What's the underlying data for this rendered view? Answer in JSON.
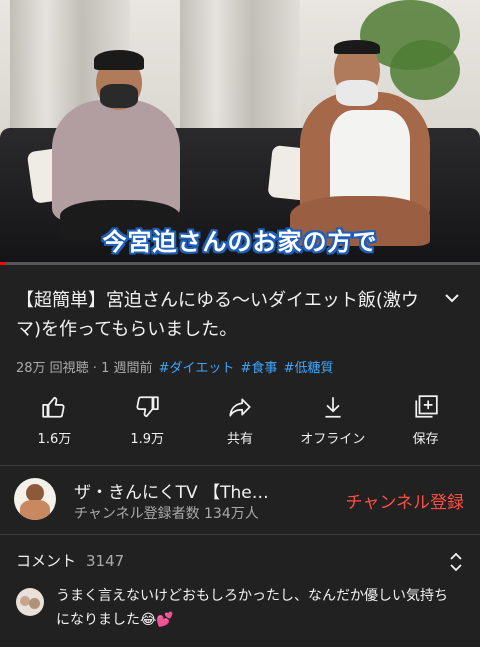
{
  "video": {
    "caption": "今宮迫さんのお家の方で",
    "progress": 0.01
  },
  "title": "【超簡単】宮迫さんにゆる〜いダイエット飯(激ウマ)を作ってもらいました。",
  "meta": {
    "views": "28万 回視聴 · 1 週間前",
    "tags": [
      "#ダイエット",
      "#食事",
      "#低糖質"
    ]
  },
  "actions": [
    {
      "icon": "thumbs-up-icon",
      "label": "1.6万"
    },
    {
      "icon": "thumbs-down-icon",
      "label": "1.9万"
    },
    {
      "icon": "share-icon",
      "label": "共有"
    },
    {
      "icon": "download-icon",
      "label": "オフライン"
    },
    {
      "icon": "save-to-playlist-icon",
      "label": "保存"
    }
  ],
  "channel": {
    "name": "ザ・きんにくTV 【The…",
    "subscribers": "チャンネル登録者数 134万人",
    "subscribe_label": "チャンネル登録"
  },
  "comments": {
    "label": "コメント",
    "count": "3147",
    "top_comment": "うまく言えないけどおもしろかったし、なんだか優しい気持ちになりました😂💕"
  },
  "colors": {
    "background": "#212121",
    "accent_red": "#ff4e45",
    "link_blue": "#3ea6ff",
    "progress_red": "#ff0000"
  }
}
